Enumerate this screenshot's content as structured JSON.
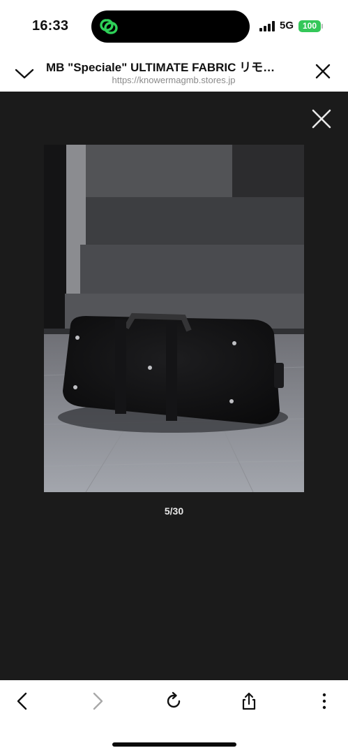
{
  "status_bar": {
    "time": "16:33",
    "network": "5G",
    "battery": "100",
    "battery_color": "#34c759",
    "island_app_icon": "link-rings-icon",
    "island_icon_color": "#2ed158"
  },
  "browser": {
    "title": "MB \"Speciale\" ULTIMATE FABRIC リモ…",
    "url": "https://knowermagmb.stores.jp",
    "icons": {
      "collapse": "chevron-down-icon",
      "close": "close-icon"
    }
  },
  "viewer": {
    "background": "#1b1b1b",
    "close_icon": "close-icon",
    "image_description_label": "product-photo",
    "counter": "5/30",
    "current_index": 5,
    "total": 30
  },
  "toolbar": {
    "back_icon": "chevron-left-icon",
    "forward_icon": "chevron-right-icon",
    "reload_icon": "reload-icon",
    "share_icon": "share-icon",
    "more_icon": "more-vertical-icon",
    "forward_disabled": true
  }
}
